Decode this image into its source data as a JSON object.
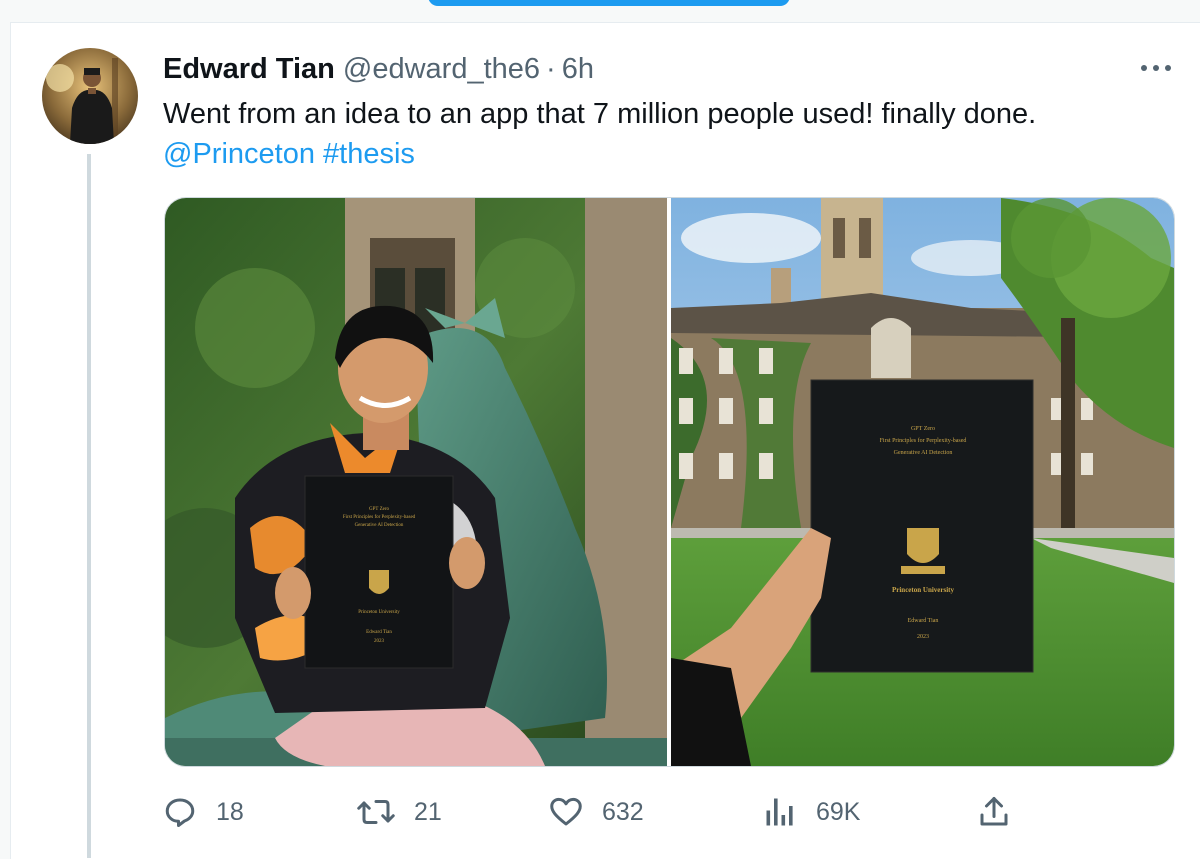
{
  "tweet": {
    "author_name": "Edward Tian",
    "handle": "@edward_the6",
    "separator": "·",
    "time": "6h",
    "text_line1": "Went from an idea to an app that 7 million people used! finally done.",
    "mention": "@Princeton",
    "hashtag": "#thesis"
  },
  "media": {
    "left_photo": {
      "book_title_1": "GPT Zero",
      "book_title_2": "First Principles for Perplexity-based",
      "book_title_3": "Generative AI Detection",
      "book_university": "Princeton University",
      "book_author": "Edward Tian",
      "book_year": "2023"
    },
    "right_photo": {
      "book_title_1": "GPT Zero",
      "book_title_2": "First Principles for Perplexity-based",
      "book_title_3": "Generative AI Detection",
      "book_university": "Princeton University",
      "book_author": "Edward Tian",
      "book_year": "2023"
    }
  },
  "actions": {
    "replies": "18",
    "retweets": "21",
    "likes": "632",
    "views": "69K"
  },
  "icons": {
    "reply": "reply-icon",
    "retweet": "retweet-icon",
    "like": "heart-icon",
    "views": "views-chart-icon",
    "share": "share-icon",
    "more": "more-options-icon"
  },
  "colors": {
    "accent": "#1d9bf0",
    "text_primary": "#0f1419",
    "text_secondary": "#536471"
  }
}
